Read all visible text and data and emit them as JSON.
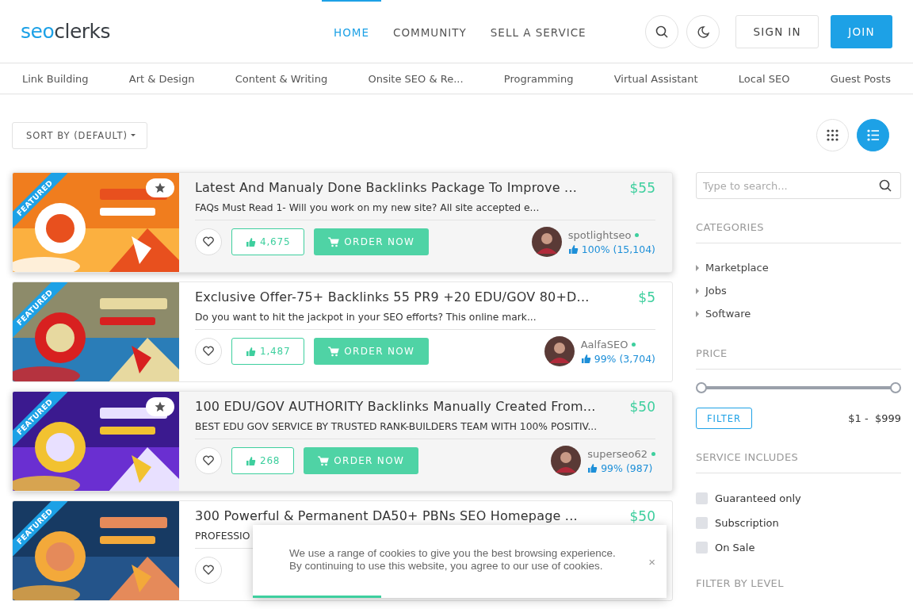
{
  "header": {
    "logo": {
      "part_1": "seo",
      "part_2": "clerks"
    },
    "nav": [
      {
        "label": "HOME",
        "selected": true
      },
      {
        "label": "COMMUNITY",
        "selected": false
      },
      {
        "label": "SELL A SERVICE",
        "selected": false
      }
    ],
    "sign_in": "SIGN IN",
    "join": "JOIN"
  },
  "categories": [
    "Link Building",
    "Art & Design",
    "Content & Writing",
    "Onsite SEO & Re...",
    "Programming",
    "Virtual Assistant",
    "Local SEO",
    "Guest Posts"
  ],
  "sort": {
    "label": "SORT BY (DEFAULT)"
  },
  "view_toggle": [
    {
      "kind": "grid",
      "selected": false
    },
    {
      "kind": "list",
      "selected": true
    }
  ],
  "gigs": [
    {
      "title": "Latest And Manualy Done Backlinks Package To Improve ...",
      "description": "FAQs Must Read 1- Will you work on my new site? All site accepted e...",
      "price": "$55",
      "likes": "4,675",
      "order": "ORDER NOW",
      "badge": "FEATURED",
      "seller": "spotlightseo",
      "online": true,
      "rating": "100% (15,104)",
      "hovered": true
    },
    {
      "title": "Exclusive Offer-75+ Backlinks 55 PR9 +20 EDU/GOV 80+D...",
      "description": "Do you want to hit the jackpot in your SEO efforts? This online mark...",
      "price": "$5",
      "likes": "1,487",
      "order": "ORDER NOW",
      "badge": "FEATURED",
      "seller": "AalfaSEO",
      "online": true,
      "rating": "99% (3,704)",
      "hovered": false
    },
    {
      "title": "100 EDU/GOV AUTHORITY Backlinks Manually Created From...",
      "description": "BEST EDU GOV SERVICE BY TRUSTED RANK-BUILDERS TEAM WITH 100% POSITIV...",
      "price": "$50",
      "likes": "268",
      "order": "ORDER NOW",
      "badge": "FEATURED",
      "seller": "superseo62",
      "online": true,
      "rating": "99% (987)",
      "hovered": true
    },
    {
      "title": "300 Powerful & Permanent DA50+ PBNs SEO Homepage ...",
      "description": "PROFESSIO",
      "price": "$50",
      "badge": "FEATURED",
      "hovered": false
    }
  ],
  "sidebar": {
    "search": {
      "placeholder": "Type to search..."
    },
    "categories_title": "CATEGORIES",
    "categories": [
      "Marketplace",
      "Jobs",
      "Software"
    ],
    "price_title": "PRICE",
    "price_slider": {
      "level": 1
    },
    "filter": "FILTER",
    "price_range": "$1 -  $999",
    "includes_title": "SERVICE INCLUDES",
    "includes": [
      {
        "label": "Guaranteed only",
        "checked": false
      },
      {
        "label": "Subscription",
        "checked": false
      },
      {
        "label": "On Sale",
        "checked": false
      }
    ],
    "level_title": "FILTER BY LEVEL"
  },
  "cookie": {
    "text": "We use a range of cookies to give you the best browsing experience.\nBy continuing to use this website, you agree to our use of cookies.",
    "close": "×",
    "level": 0.31
  }
}
